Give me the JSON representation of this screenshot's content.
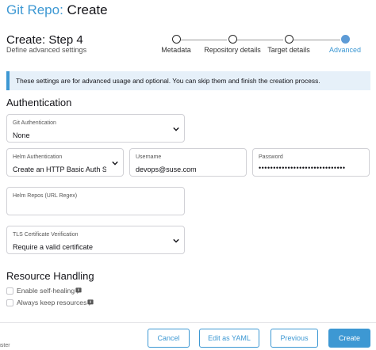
{
  "header": {
    "breadcrumb": "Git Repo:",
    "title": "Create"
  },
  "step": {
    "title": "Create: Step 4",
    "subtitle": "Define advanced settings"
  },
  "stepper": {
    "steps": [
      {
        "label": "Metadata",
        "active": false
      },
      {
        "label": "Repository details",
        "active": false
      },
      {
        "label": "Target details",
        "active": false
      },
      {
        "label": "Advanced",
        "active": true
      }
    ]
  },
  "banner": {
    "text": "These settings are for advanced usage and optional. You can skip them and finish the creation process."
  },
  "authentication": {
    "heading": "Authentication",
    "git_auth": {
      "label": "Git Authentication",
      "value": "None"
    },
    "helm_auth": {
      "label": "Helm Authentication",
      "value": "Create an HTTP Basic Auth S..."
    },
    "username": {
      "label": "Username",
      "value": "devops@suse.com"
    },
    "password": {
      "label": "Password",
      "value": "••••••••••••••••••••••••••••••"
    },
    "helm_repos": {
      "label": "Helm Repos (URL Regex)",
      "value": ""
    },
    "tls": {
      "label": "TLS Certificate Verification",
      "value": "Require a valid certificate"
    }
  },
  "resource_handling": {
    "heading": "Resource Handling",
    "self_healing": {
      "label": "Enable self-healing",
      "checked": false
    },
    "keep_resources": {
      "label": "Always keep resources",
      "checked": false
    }
  },
  "footer": {
    "cancel": "Cancel",
    "edit_yaml": "Edit as YAML",
    "previous": "Previous",
    "create": "Create"
  },
  "side_fragment": "uster",
  "colors": {
    "accent": "#3d98d3",
    "banner_bg": "#e6f0f9"
  }
}
